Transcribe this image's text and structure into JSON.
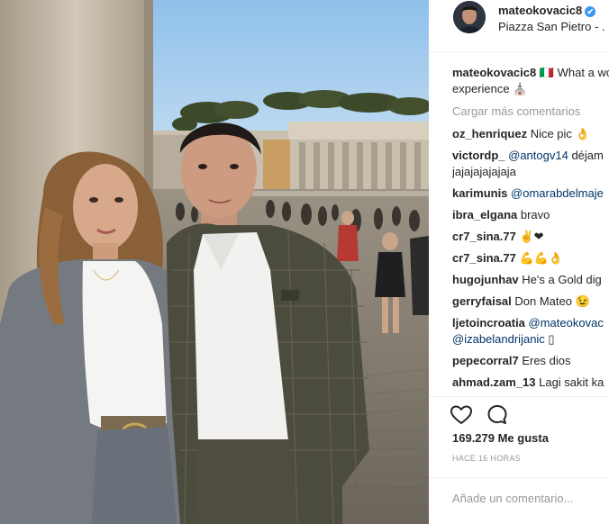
{
  "post": {
    "username": "mateokovacic8",
    "verified_glyph": "✔",
    "location": "Piazza San Pietro - ."
  },
  "comments": {
    "load_more": "Cargar más comentarios",
    "items": [
      {
        "user": "mateokovacic8",
        "text": " 🇮🇹 What a wo",
        "cont": "experience ⛪"
      },
      {
        "user": "oz_henriquez",
        "text": " Nice pic 👌"
      },
      {
        "user": "victordp_",
        "mention": " @antogv14",
        "text": " déjam",
        "cont": "jajajajajajaja"
      },
      {
        "user": "karimunis",
        "mention": " @omarabdelmaje",
        "text": ""
      },
      {
        "user": "ibra_elgana",
        "text": " bravo"
      },
      {
        "user": "cr7_sina.77",
        "text": " ✌️❤"
      },
      {
        "user": "cr7_sina.77",
        "text": " 💪💪👌"
      },
      {
        "user": "hugojunhav",
        "text": " He's a Gold dig"
      },
      {
        "user": "gerryfaisal",
        "text": " Don Mateo 😉"
      },
      {
        "user": "ljetoincroatia",
        "mention": " @mateokovac",
        "text": "",
        "cont_mention": "@izabelandrijanic",
        "cont": " ▯"
      },
      {
        "user": "pepecorral7",
        "text": " Eres dios"
      },
      {
        "user": "ahmad.zam_13",
        "text": " Lagi sakit ka"
      }
    ]
  },
  "actions": {
    "like_icon": "heart-icon",
    "comment_icon": "comment-bubble-icon",
    "likes_text": "169.279 Me gusta",
    "time_text": "HACE 16 HORAS"
  },
  "add_comment": {
    "placeholder": "Añade un comentario..."
  },
  "colors": {
    "text": "#262626",
    "muted": "#999999",
    "link": "#003569",
    "verified": "#3897f0",
    "divider": "#efefef"
  }
}
